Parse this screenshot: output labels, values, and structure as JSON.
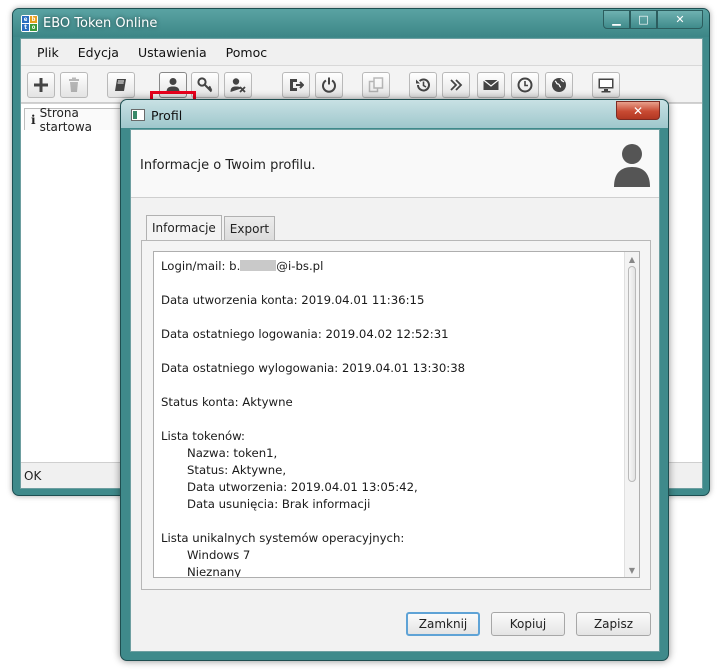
{
  "main_window": {
    "title": "EBO Token Online",
    "app_icon_chars": [
      "e",
      "b",
      "t",
      "o"
    ],
    "controls": {
      "minimize": "▁",
      "maximize": "□",
      "close": "✕"
    },
    "menu": [
      "Plik",
      "Edycja",
      "Ustawienia",
      "Pomoc"
    ],
    "toolbar_icons": [
      "add-icon",
      "trash-icon",
      "book-icon",
      "user-icon",
      "key-icon",
      "user-remove-icon",
      "logout-icon",
      "power-icon",
      "copy-icon",
      "history-icon",
      "double-chevron-icon",
      "envelope-icon",
      "clock-icon",
      "globe-icon",
      "monitor-icon"
    ],
    "start_tab": {
      "icon": "i",
      "label": "Strona startowa"
    },
    "status": "OK"
  },
  "dialog": {
    "title": "Profil",
    "close": "✕",
    "header": "Informacje o Twoim profilu.",
    "tabs": [
      "Informacje",
      "Export"
    ],
    "info": {
      "login_prefix": "Login/mail: b.",
      "login_suffix": "@i-bs.pl",
      "created": "Data utworzenia konta: 2019.04.01 11:36:15",
      "last_login": "Data ostatniego logowania: 2019.04.02 12:52:31",
      "last_logout": "Data ostatniego wylogowania: 2019.04.01 13:30:38",
      "status": "Status konta: Aktywne",
      "tokens_header": "Lista tokenów:",
      "token_name": "Nazwa: token1,",
      "token_status": "Status: Aktywne,",
      "token_created": "Data utworzenia: 2019.04.01 13:05:42,",
      "token_deleted": "Data usunięcia: Brak informacji",
      "os_header": "Lista unikalnych systemów operacyjnych:",
      "os_1": "Windows 7",
      "os_2": "Nieznany"
    },
    "buttons": {
      "close": "Zamknij",
      "copy": "Kopiuj",
      "save": "Zapisz"
    }
  },
  "colors": {
    "frame": "#3f8a8b",
    "highlight": "#e8001c",
    "default_button": "#5fa3d6"
  }
}
